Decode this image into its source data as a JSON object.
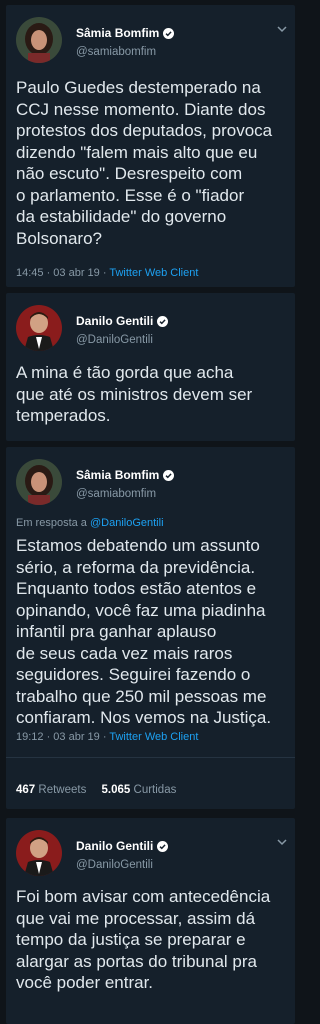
{
  "tweets": [
    {
      "name": "Sâmia Bomfim",
      "handle": "@samiabomfim",
      "text": "Paulo Guedes destemperado na\nCCJ nesse momento. Diante dos\nprotestos dos deputados, provoca\ndizendo \"falem mais alto que eu\nnão escuto\". Desrespeito com\no parlamento. Esse é o \"fiador\nda estabilidade\" do governo\nBolsonaro?",
      "time": "14:45 · 03 abr 19 ·",
      "client": "Twitter Web Client"
    },
    {
      "name": "Danilo Gentili",
      "handle": "@DaniloGentili",
      "text": "A mina é tão gorda que acha\nque até os ministros devem ser\ntemperados."
    },
    {
      "name": "Sâmia Bomfim",
      "handle": "@samiabomfim",
      "reply_prefix": "Em resposta a",
      "reply_to": "@DaniloGentili",
      "text": "Estamos debatendo um assunto\nsério, a reforma da previdência.\nEnquanto todos estão atentos e\nopinando, você faz uma piadinha\ninfantil pra ganhar aplauso\nde seus cada vez mais raros\nseguidores. Seguirei fazendo o\ntrabalho que 250 mil pessoas me\nconfiaram. Nos vemos na Justiça.",
      "time": "19:12 · 03 abr 19 ·",
      "client": "Twitter Web Client",
      "retweets_count": "467",
      "retweets_label": "Retweets",
      "likes_count": "5.065",
      "likes_label": "Curtidas"
    },
    {
      "name": "Danilo Gentili",
      "handle": "@DaniloGentili",
      "text": "Foi bom avisar com antecedência\nque vai me processar, assim dá\ntempo da justiça se preparar e\nalargar as portas do tribunal pra\nvocê poder entrar."
    }
  ],
  "colors": {
    "background": "#0f1419",
    "card": "#15202b",
    "link": "#1da1f2",
    "muted": "#8899a6"
  },
  "icons": [
    "verified-badge-icon",
    "chevron-down-icon"
  ]
}
